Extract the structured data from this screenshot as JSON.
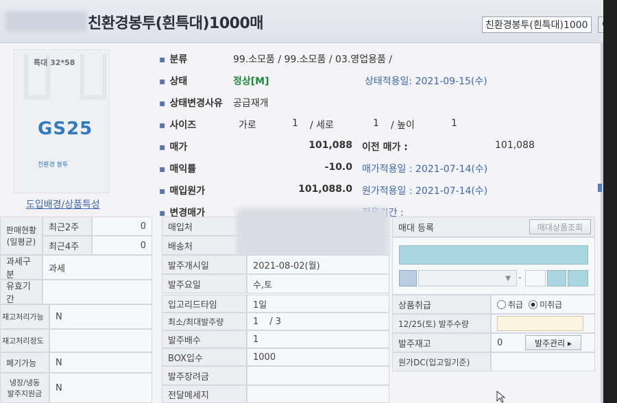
{
  "header": {
    "title": "친환경봉투(흰특대)1000매",
    "search_value": "친환경봉투(흰특대)1000",
    "search_icon": "search-icon"
  },
  "product_image": {
    "size_label": "특대 32*58",
    "brand": "GS25",
    "sub_text": "친환경 봉투",
    "link": "도입배경/상품특성"
  },
  "fields": {
    "category_label": "분류",
    "category_value": "99.소모품 / 99.소모품 / 03.영업용품 /",
    "status_label": "상태",
    "status_value": "정상[M]",
    "status_date": "상태적용일: 2021-09-15(수)",
    "status_reason_label": "상태변경사유",
    "status_reason_value": "공급재개",
    "size_label": "사이즈",
    "size_w_label": "가로",
    "size_w": "1",
    "size_h_label": "/ 세로",
    "size_h": "1",
    "size_d_label": "/ 높이",
    "size_d": "1",
    "price_label": "매가",
    "price_value": "101,088",
    "prev_price_label": "이전 매가 :",
    "prev_price_value": "101,088",
    "margin_label": "매익률",
    "margin_value": "-10.0",
    "price_date": "매가적용일 : 2021-07-14(수)",
    "cost_label": "매입원가",
    "cost_value": "101,088.0",
    "cost_date": "원가적용일 : 2021-07-14(수)",
    "changed_price_label": "변경매가",
    "apply_period": "적용기간 :"
  },
  "left_panel": {
    "sales_label_1": "판매현황",
    "sales_label_2": "(일평균)",
    "recent2w_label": "최근2주",
    "recent2w_value": "0",
    "recent4w_label": "최근4주",
    "recent4w_value": "0",
    "tax_label": "과세구분",
    "tax_value": "과세",
    "expiry_label": "유효기간",
    "expiry_value": "",
    "return_label": "재고처리가능",
    "return_value": "N",
    "return_level_label": "재고처리정도",
    "disposal_label": "폐기가능",
    "disposal_value": "N",
    "frozen_label_1": "냉장/냉동",
    "frozen_label_2": "발주지원금",
    "frozen_value": "N"
  },
  "order_panel": {
    "supplier_label": "매입처",
    "delivery_label": "배송처",
    "order_start_label": "발주개시일",
    "order_start_value": "2021-08-02(월)",
    "order_days_label": "발주요일",
    "order_days_value": "수,토",
    "lead_time_label": "입고리드타임",
    "lead_time_value": "1일",
    "min_max_label": "최소/최대발주량",
    "min_value": "1",
    "max_value": "/ 3",
    "multiple_label": "발주배수",
    "multiple_value": "1",
    "box_label": "BOX입수",
    "box_value": "1000",
    "incentive_label": "발주장려금",
    "message_label": "전달메세지"
  },
  "right_panel": {
    "register_label": "매대 등록",
    "lookup_button": "매대상품조회",
    "handling_label": "상품취급",
    "handling_opt1": "취급",
    "handling_opt2": "미취급",
    "handling_selected": "미취급",
    "order_qty_label": "12/25(토) 발주수량",
    "order_stock_label": "발주재고",
    "order_stock_value": "0",
    "order_manage_button": "발주관리 ▸",
    "cost_dc_label": "원가DC(입고일기준)"
  },
  "colors": {
    "accent": "#3a67b8",
    "status_green": "#1d8a3a",
    "brand_blue": "#2f7bc0",
    "input_blue": "#a9d4e0"
  }
}
